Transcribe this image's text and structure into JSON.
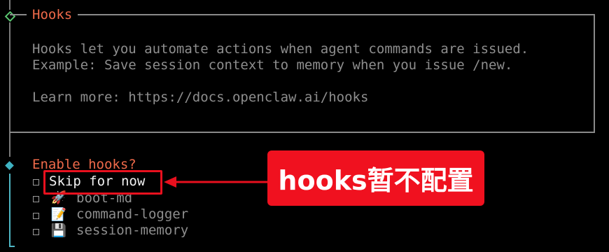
{
  "hooks_panel": {
    "title": "Hooks",
    "lines": [
      "Hooks let you automate actions when agent commands are issued.",
      "Example: Save session context to memory when you issue /new.",
      "",
      "Learn more: https://docs.openclaw.ai/hooks"
    ]
  },
  "prompt": {
    "question": "Enable hooks?",
    "options": [
      {
        "label": "Skip for now",
        "icon": ""
      },
      {
        "label": "boot-md",
        "icon": "rocket-icon"
      },
      {
        "label": "command-logger",
        "icon": "memo-icon"
      },
      {
        "label": "session-memory",
        "icon": "floppy-disk-icon"
      }
    ]
  },
  "annotation": {
    "callout_text": "hooks暂不配置"
  },
  "colors": {
    "title": "#ef6a4a",
    "accent_teal": "#3fb2c2",
    "accent_green": "#59c46f",
    "annotation_red": "#f0111f"
  }
}
